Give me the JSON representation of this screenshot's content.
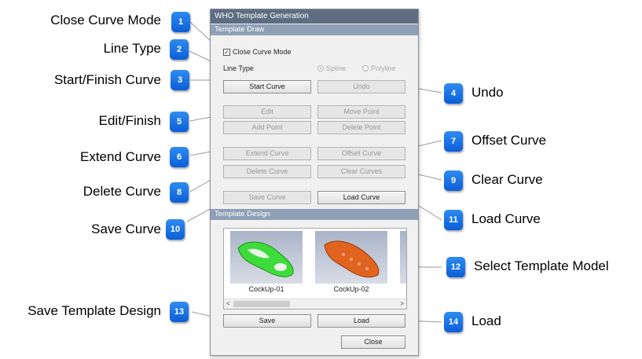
{
  "callouts": [
    {
      "num": "1",
      "label": "Close Curve Mode"
    },
    {
      "num": "2",
      "label": "Line Type"
    },
    {
      "num": "3",
      "label": "Start/Finish Curve"
    },
    {
      "num": "4",
      "label": "Undo"
    },
    {
      "num": "5",
      "label": "Edit/Finish"
    },
    {
      "num": "6",
      "label": "Extend Curve"
    },
    {
      "num": "7",
      "label": "Offset Curve"
    },
    {
      "num": "8",
      "label": "Delete Curve"
    },
    {
      "num": "9",
      "label": "Clear Curve"
    },
    {
      "num": "10",
      "label": "Save Curve"
    },
    {
      "num": "11",
      "label": "Load Curve"
    },
    {
      "num": "12",
      "label": "Select Template Model"
    },
    {
      "num": "13",
      "label": "Save Template Design"
    },
    {
      "num": "14",
      "label": "Load"
    }
  ],
  "window": {
    "title": "WHO Template Generation",
    "section_draw": "Template Draw",
    "section_design": "Template Design"
  },
  "draw": {
    "close_curve_mode": "Close Curve Mode",
    "close_curve_checked": true,
    "line_type_label": "Line Type",
    "spline": "Spline",
    "polyline": "Polyline",
    "start_curve": "Start Curve",
    "undo": "Undo",
    "edit": "Edit",
    "move_point": "Move Point",
    "add_point": "Add Point",
    "delete_point": "Delete Point",
    "extend_curve": "Extend Curve",
    "offset_curve": "Offset Curve",
    "delete_curve": "Delete Curve",
    "clear_curves": "Clear Curves",
    "save_curve": "Save Curve",
    "load_curve": "Load Curve"
  },
  "design": {
    "models": [
      {
        "name": "CockUp-01",
        "color": "#3ddc3a"
      },
      {
        "name": "CockUp-02",
        "color": "#e0631f"
      }
    ],
    "save": "Save",
    "load": "Load",
    "close": "Close"
  },
  "colors": {
    "badge": "#1a6fe6",
    "titlebar": "#5f6d82",
    "section": "#8f9fb5"
  }
}
